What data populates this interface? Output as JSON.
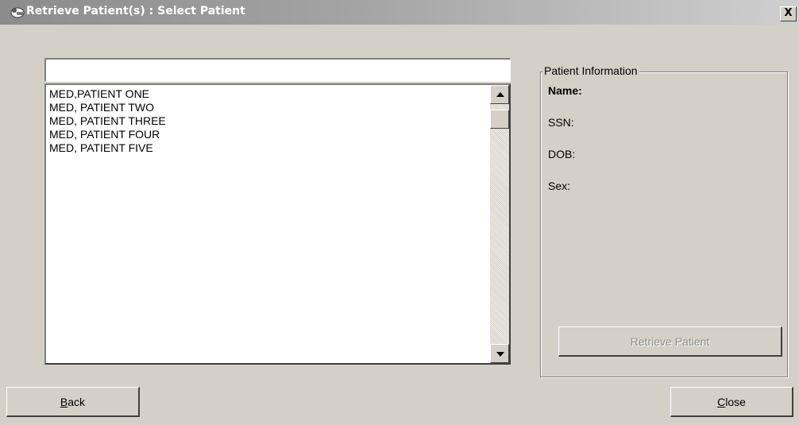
{
  "window": {
    "title": "Retrieve Patient(s) : Select Patient",
    "close_label": "X"
  },
  "search": {
    "value": "",
    "placeholder": ""
  },
  "patients": [
    "MED,PATIENT ONE",
    "MED, PATIENT TWO",
    "MED, PATIENT THREE",
    "MED, PATIENT FOUR",
    "MED, PATIENT FIVE"
  ],
  "patient_info": {
    "legend": "Patient Information",
    "name_label": "Name:",
    "ssn_label": "SSN:",
    "dob_label": "DOB:",
    "sex_label": "Sex:",
    "retrieve_button": "Retrieve Patient"
  },
  "footer": {
    "back_mnemonic": "B",
    "back_rest": "ack",
    "close_mnemonic": "C",
    "close_rest": "lose"
  },
  "icons": {
    "title_icon": "patient-icon",
    "scroll_up": "arrow-up-icon",
    "scroll_down": "arrow-down-icon"
  },
  "colors": {
    "dialog_background": "#d4d0c8",
    "titlebar_gradient_start": "#8c8c8c",
    "titlebar_gradient_end": "#cfcfcf",
    "disabled_text": "#8e8c86"
  }
}
